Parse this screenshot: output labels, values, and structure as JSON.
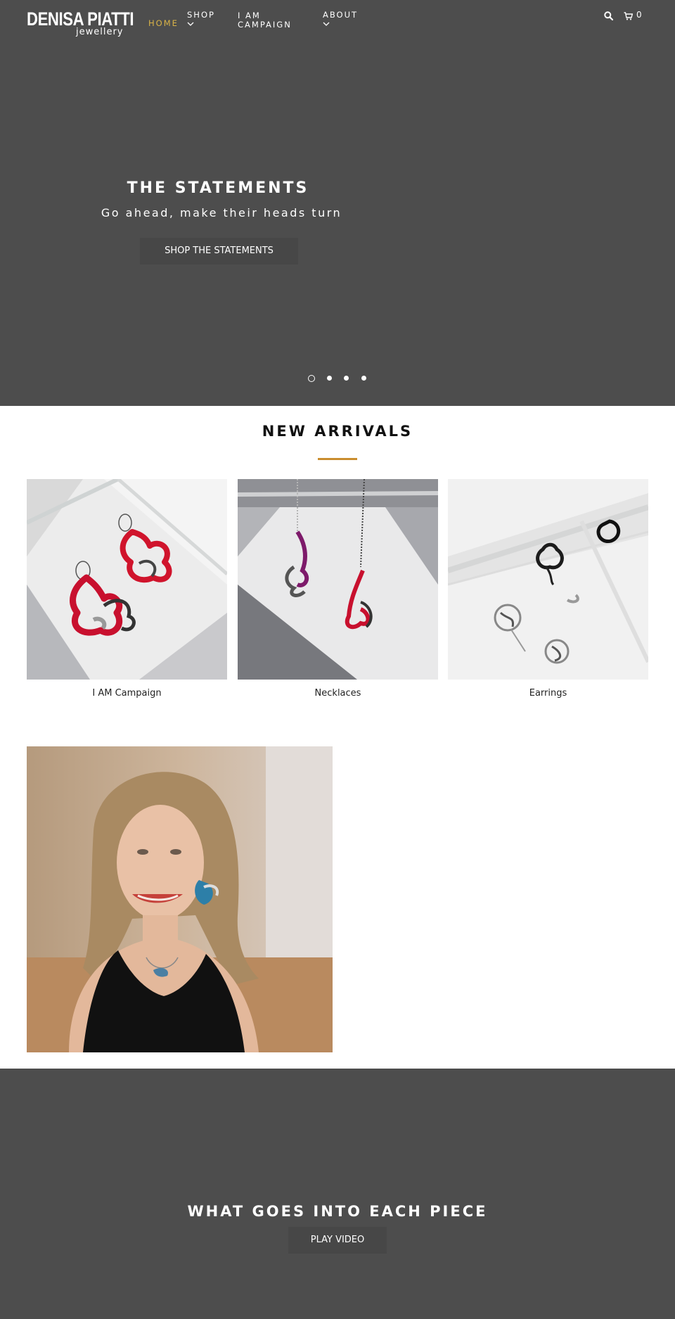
{
  "brand": {
    "name": "DENISA PIATTI",
    "tagline": "jewellery"
  },
  "nav": {
    "home": "HOME",
    "shop": "SHOP",
    "campaign_line1": "I AM",
    "campaign_line2": "CAMPAIGN",
    "about": "ABOUT",
    "active_color": "#d9b347"
  },
  "header_icons": {
    "search": "search-icon",
    "cart": "cart-icon",
    "cart_count": "0"
  },
  "hero": {
    "title": "THE STATEMENTS",
    "subtitle": "Go ahead, make their heads turn",
    "button": "SHOP THE STATEMENTS",
    "slide_count": 4,
    "active_slide": 1,
    "background": "#4d4d4d"
  },
  "new_arrivals": {
    "title": "NEW ARRIVALS",
    "accent": "#c98d2e",
    "items": [
      {
        "label": "I AM Campaign"
      },
      {
        "label": "Necklaces"
      },
      {
        "label": "Earrings"
      }
    ]
  },
  "video": {
    "title": "WHAT GOES INTO EACH PIECE",
    "button": "PLAY VIDEO"
  }
}
